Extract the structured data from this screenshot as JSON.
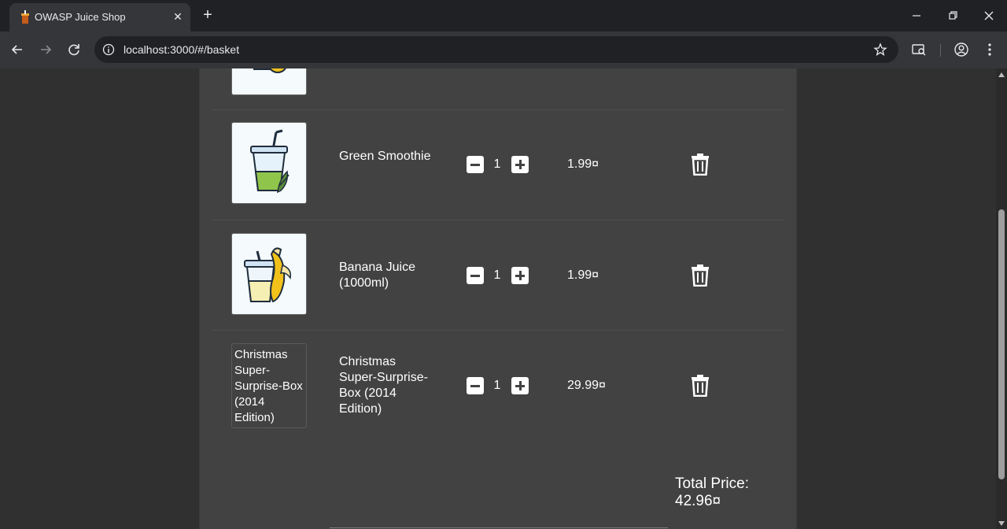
{
  "browser": {
    "tab_title": "OWASP Juice Shop",
    "url": "localhost:3000/#/basket"
  },
  "basket": {
    "items": [
      {
        "name": "Green Smoothie",
        "quantity": "1",
        "price": "1.99¤",
        "image": "green-smoothie-icon"
      },
      {
        "name": "Banana Juice (1000ml)",
        "quantity": "1",
        "price": "1.99¤",
        "image": "banana-juice-icon"
      },
      {
        "name": "Christmas Super-Surprise-Box (2014 Edition)",
        "quantity": "1",
        "price": "29.99¤",
        "image_alt": "Christmas Super-Surprise-Box (2014 Edition)"
      }
    ],
    "total_label": "Total Price: 42.96¤"
  },
  "colors": {
    "page_bg": "#303030",
    "card_bg": "#424242",
    "text": "#ffffff"
  }
}
